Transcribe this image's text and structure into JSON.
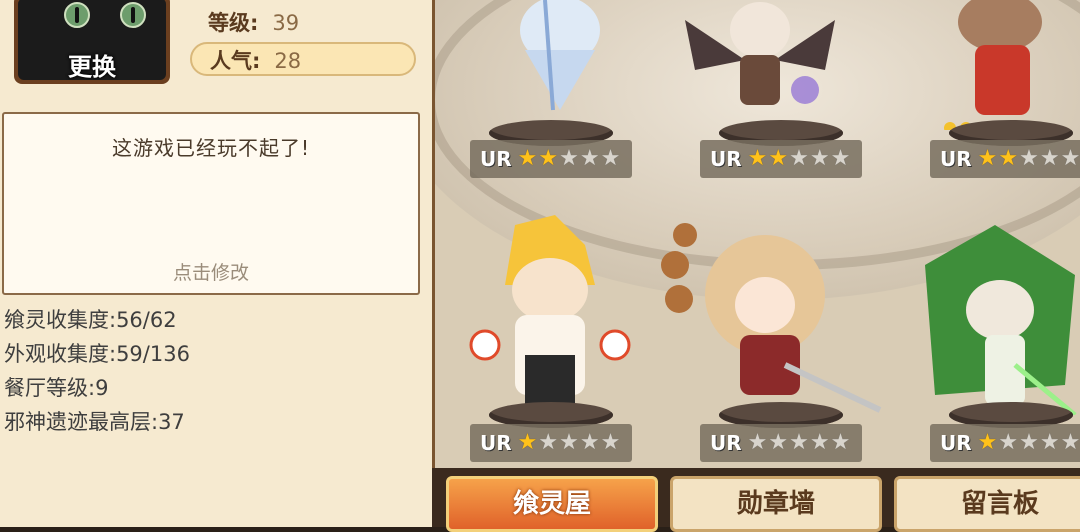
{
  "profile": {
    "change_button": "更换",
    "level_key": "等级:",
    "level_value": "39",
    "popularity_key": "人气:",
    "popularity_value": "28"
  },
  "message": {
    "text": "这游戏已经玩不起了!",
    "hint": "点击修改"
  },
  "stats": [
    "飨灵收集度:56/62",
    "外观收集度:59/136",
    "餐厅等级:9",
    "邪神遗迹最高层:37"
  ],
  "characters": [
    {
      "rank": "UR",
      "stars": 2
    },
    {
      "rank": "UR",
      "stars": 2
    },
    {
      "rank": "UR",
      "stars": 2
    },
    {
      "rank": "UR",
      "stars": 1
    },
    {
      "rank": "UR",
      "stars": 0
    },
    {
      "rank": "UR",
      "stars": 1
    }
  ],
  "tabs": [
    "飨灵屋",
    "勋章墙",
    "留言板"
  ],
  "colors": {
    "panel_bg": "#f6ead0",
    "star_on": "#ffc21a",
    "active_tab": "#e0622a"
  }
}
